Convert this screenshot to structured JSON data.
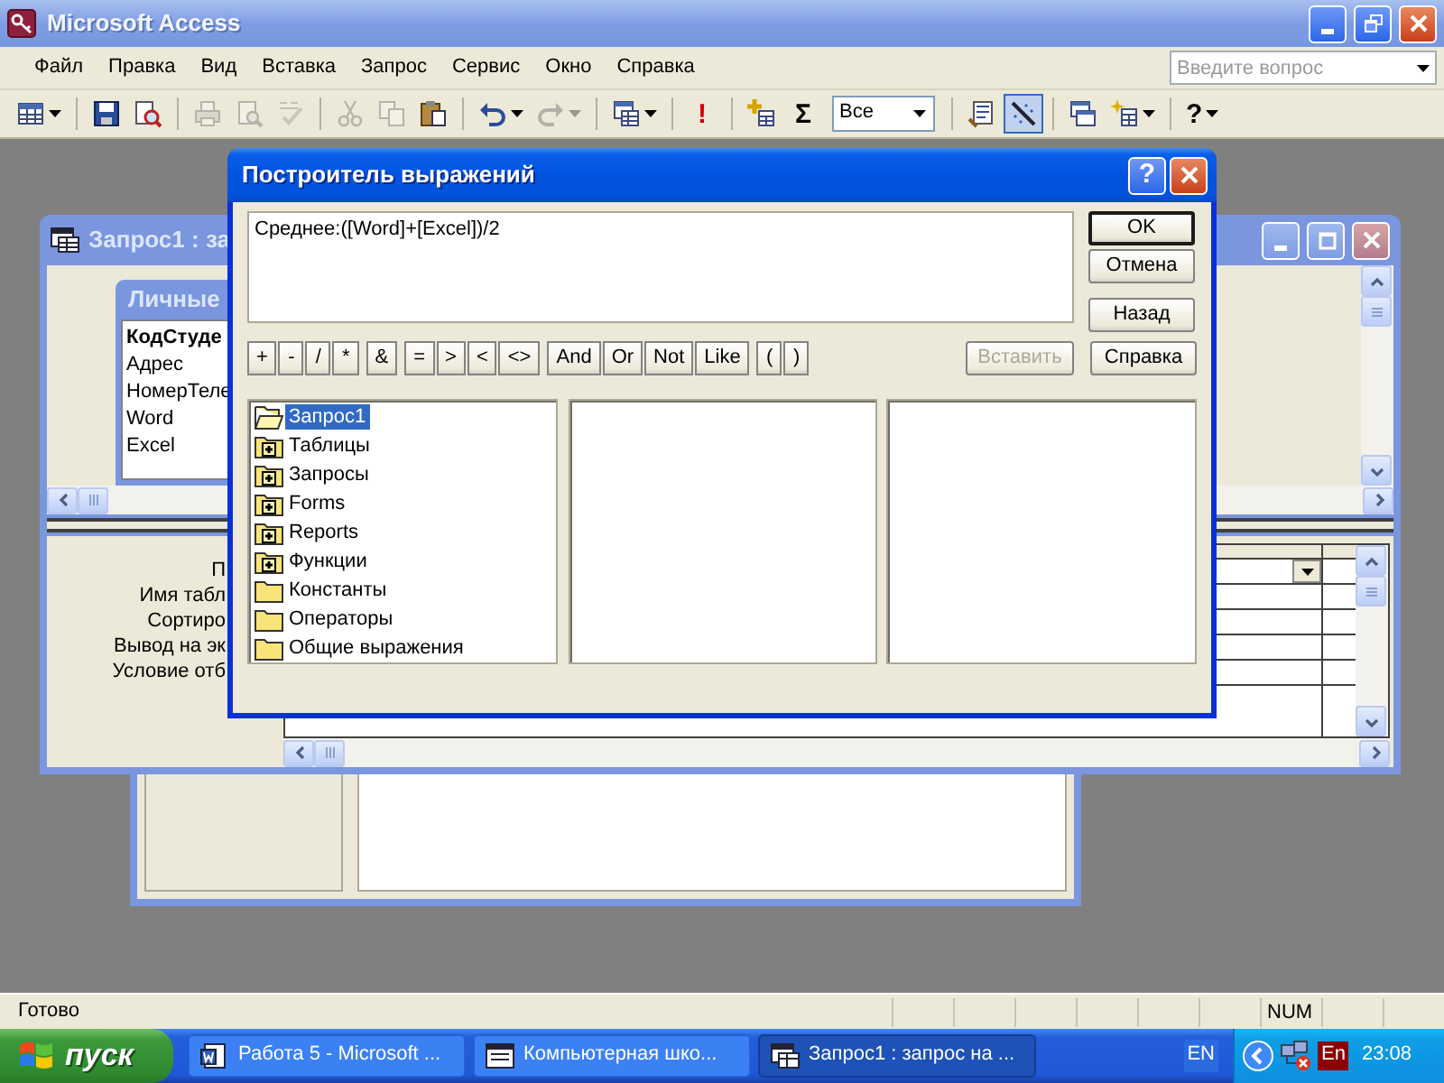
{
  "window": {
    "title": "Microsoft Access"
  },
  "menu": [
    "Файл",
    "Правка",
    "Вид",
    "Вставка",
    "Запрос",
    "Сервис",
    "Окно",
    "Справка"
  ],
  "help_box": {
    "placeholder": "Введите вопрос"
  },
  "toolbar": [
    {
      "kind": "button",
      "disabled": false,
      "pressed": false,
      "dropdown": true
    },
    {
      "kind": "separator"
    },
    {
      "kind": "button",
      "disabled": false,
      "pressed": false,
      "dropdown": false
    },
    {
      "kind": "button",
      "disabled": false,
      "pressed": false,
      "dropdown": false
    },
    {
      "kind": "separator"
    },
    {
      "kind": "button",
      "disabled": true,
      "pressed": false,
      "dropdown": false
    },
    {
      "kind": "button",
      "disabled": true,
      "pressed": false,
      "dropdown": false
    },
    {
      "kind": "button",
      "disabled": true,
      "pressed": false,
      "dropdown": false
    },
    {
      "kind": "separator"
    },
    {
      "kind": "button",
      "disabled": true,
      "pressed": false,
      "dropdown": false
    },
    {
      "kind": "button",
      "disabled": true,
      "pressed": false,
      "dropdown": false
    },
    {
      "kind": "button",
      "disabled": false,
      "pressed": false,
      "dropdown": false
    },
    {
      "kind": "separator"
    },
    {
      "kind": "button",
      "disabled": false,
      "pressed": false,
      "dropdown": true
    },
    {
      "kind": "button",
      "disabled": true,
      "pressed": false,
      "dropdown": true
    },
    {
      "kind": "separator"
    },
    {
      "kind": "button",
      "disabled": false,
      "pressed": false,
      "dropdown": true
    },
    {
      "kind": "separator"
    },
    {
      "kind": "button",
      "disabled": false,
      "pressed": false,
      "dropdown": false,
      "label": "!"
    },
    {
      "kind": "separator"
    },
    {
      "kind": "button",
      "disabled": false,
      "pressed": false,
      "dropdown": false
    },
    {
      "kind": "button",
      "disabled": false,
      "pressed": false,
      "dropdown": false,
      "label": "Σ"
    },
    {
      "kind": "combo",
      "value": "Все"
    },
    {
      "kind": "separator"
    },
    {
      "kind": "button",
      "disabled": false,
      "pressed": false,
      "dropdown": false
    },
    {
      "kind": "button",
      "disabled": false,
      "pressed": true,
      "dropdown": false
    },
    {
      "kind": "separator"
    },
    {
      "kind": "button",
      "disabled": false,
      "pressed": false,
      "dropdown": false
    },
    {
      "kind": "button",
      "disabled": false,
      "pressed": false,
      "dropdown": true
    },
    {
      "kind": "separator"
    },
    {
      "kind": "button",
      "disabled": false,
      "pressed": false,
      "dropdown": true,
      "label": "?"
    }
  ],
  "query_window": {
    "title": "Запрос1 : за",
    "table": {
      "title": "Личные",
      "fields": [
        {
          "name": "КодСтуде",
          "key": true
        },
        {
          "name": "Адрес",
          "key": false
        },
        {
          "name": "НомерТеле",
          "key": false
        },
        {
          "name": "Word",
          "key": false
        },
        {
          "name": "Excel",
          "key": false
        }
      ]
    },
    "grid_rows": [
      "П",
      "Имя табл",
      "Сортиро",
      "Вывод на эк",
      "Условие отб"
    ]
  },
  "dialog": {
    "title": "Построитель выражений",
    "help_button": "?",
    "expression": "Среднее:([Word]+[Excel])/2",
    "buttons": [
      {
        "label": "OK",
        "default": true
      },
      {
        "label": "Отмена",
        "default": false
      },
      {
        "label": "Назад",
        "default": false
      }
    ],
    "operator_groups": [
      [
        "+",
        "-",
        "/",
        "*"
      ],
      [
        "&"
      ],
      [
        "=",
        ">",
        "<",
        "<>"
      ],
      [
        "And",
        "Or",
        "Not",
        "Like"
      ],
      [
        "(",
        ")"
      ]
    ],
    "paste_button": {
      "label": "Вставить",
      "disabled": true
    },
    "help_action": {
      "label": "Справка",
      "disabled": false
    },
    "tree": [
      {
        "label": "Запрос1",
        "kind": "open",
        "selected": true
      },
      {
        "label": "Таблицы",
        "kind": "plus",
        "selected": false
      },
      {
        "label": "Запросы",
        "kind": "plus",
        "selected": false
      },
      {
        "label": "Forms",
        "kind": "plus",
        "selected": false
      },
      {
        "label": "Reports",
        "kind": "plus",
        "selected": false
      },
      {
        "label": "Функции",
        "kind": "plus",
        "selected": false
      },
      {
        "label": "Константы",
        "kind": "plain",
        "selected": false
      },
      {
        "label": "Операторы",
        "kind": "plain",
        "selected": false
      },
      {
        "label": "Общие выражения",
        "kind": "plain",
        "selected": false
      }
    ]
  },
  "status_bar": {
    "text": "Готово",
    "indicator": "NUM"
  },
  "taskbar": {
    "start": "пуск",
    "tasks": [
      {
        "label": "Работа 5 - Microsoft ...",
        "selected": false
      },
      {
        "label": "Компьютерная шко...",
        "selected": false
      },
      {
        "label": "Запрос1 : запрос на ...",
        "selected": true
      }
    ],
    "language": "EN",
    "tray_language": "En",
    "clock": "23:08"
  }
}
